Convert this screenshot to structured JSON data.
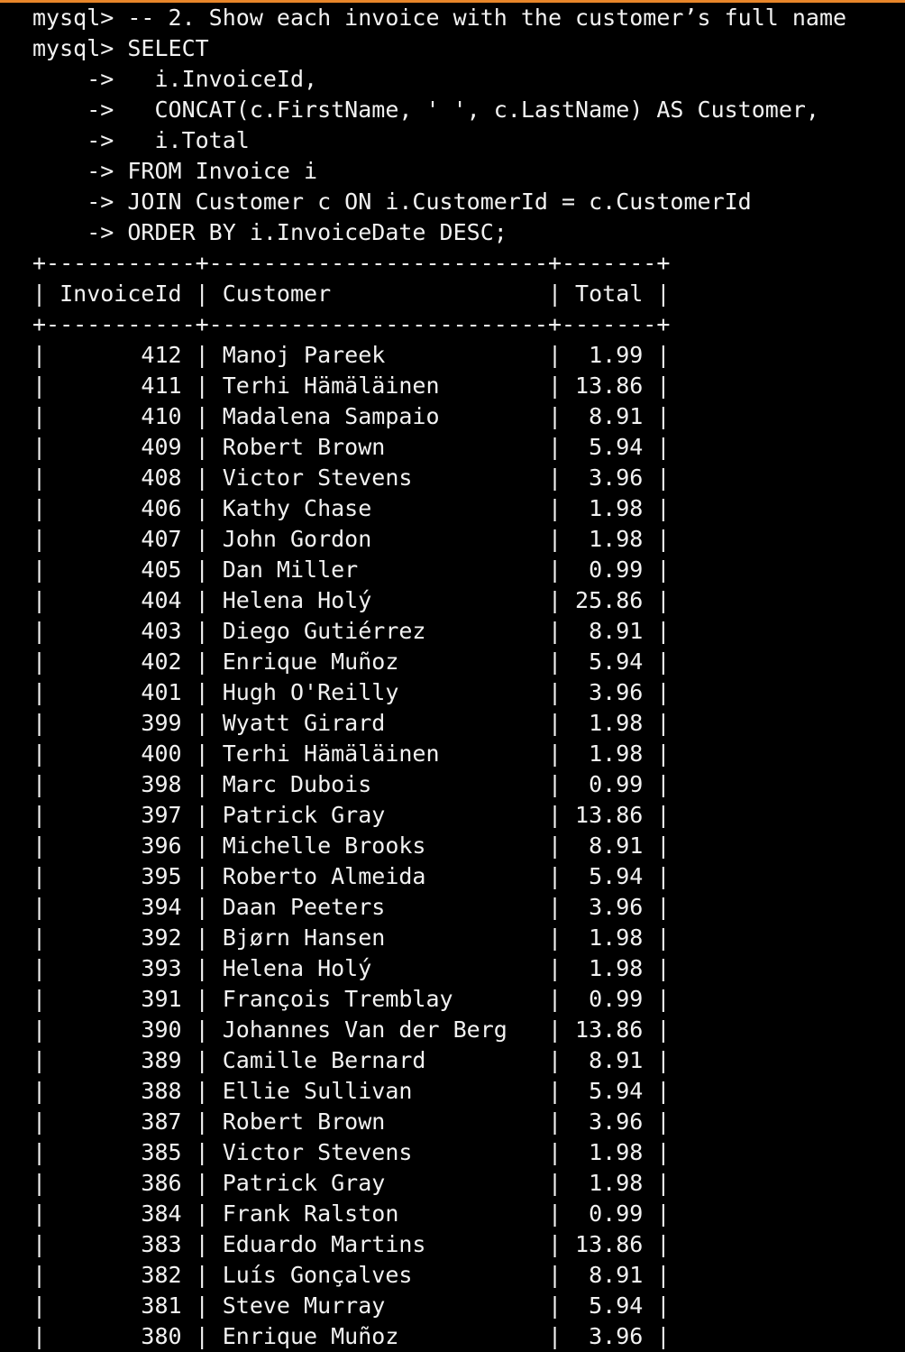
{
  "theme": {
    "background": "#000000",
    "foreground": "#f2f2f2",
    "accent": "#e8862a"
  },
  "session": {
    "prompt": "mysql>",
    "continuation": "    ->",
    "lines": [
      "mysql> -- 2. Show each invoice with the customer’s full name",
      "mysql> SELECT",
      "    ->   i.InvoiceId,",
      "    ->   CONCAT(c.FirstName, ' ', c.LastName) AS Customer,",
      "    ->   i.Total",
      "    -> FROM Invoice i",
      "    -> JOIN Customer c ON i.CustomerId = c.CustomerId",
      "    -> ORDER BY i.InvoiceDate DESC;"
    ]
  },
  "result_table": {
    "border": "+-----------+-------------------------+-------+",
    "header": "| InvoiceId | Customer                | Total |",
    "columns": [
      "InvoiceId",
      "Customer",
      "Total"
    ],
    "rows": [
      {
        "id": "412",
        "customer": "Manoj Pareek",
        "total": "1.99",
        "line": "|       412 | Manoj Pareek            |  1.99 |"
      },
      {
        "id": "411",
        "customer": "Terhi Hämäläinen",
        "total": "13.86",
        "line": "|       411 | Terhi Hämäläinen        | 13.86 |"
      },
      {
        "id": "410",
        "customer": "Madalena Sampaio",
        "total": "8.91",
        "line": "|       410 | Madalena Sampaio        |  8.91 |"
      },
      {
        "id": "409",
        "customer": "Robert Brown",
        "total": "5.94",
        "line": "|       409 | Robert Brown            |  5.94 |"
      },
      {
        "id": "408",
        "customer": "Victor Stevens",
        "total": "3.96",
        "line": "|       408 | Victor Stevens          |  3.96 |"
      },
      {
        "id": "406",
        "customer": "Kathy Chase",
        "total": "1.98",
        "line": "|       406 | Kathy Chase             |  1.98 |"
      },
      {
        "id": "407",
        "customer": "John Gordon",
        "total": "1.98",
        "line": "|       407 | John Gordon             |  1.98 |"
      },
      {
        "id": "405",
        "customer": "Dan Miller",
        "total": "0.99",
        "line": "|       405 | Dan Miller              |  0.99 |"
      },
      {
        "id": "404",
        "customer": "Helena Holý",
        "total": "25.86",
        "line": "|       404 | Helena Holý             | 25.86 |"
      },
      {
        "id": "403",
        "customer": "Diego Gutiérrez",
        "total": "8.91",
        "line": "|       403 | Diego Gutiérrez         |  8.91 |"
      },
      {
        "id": "402",
        "customer": "Enrique Muñoz",
        "total": "5.94",
        "line": "|       402 | Enrique Muñoz           |  5.94 |"
      },
      {
        "id": "401",
        "customer": "Hugh O'Reilly",
        "total": "3.96",
        "line": "|       401 | Hugh O'Reilly           |  3.96 |"
      },
      {
        "id": "399",
        "customer": "Wyatt Girard",
        "total": "1.98",
        "line": "|       399 | Wyatt Girard            |  1.98 |"
      },
      {
        "id": "400",
        "customer": "Terhi Hämäläinen",
        "total": "1.98",
        "line": "|       400 | Terhi Hämäläinen        |  1.98 |"
      },
      {
        "id": "398",
        "customer": "Marc Dubois",
        "total": "0.99",
        "line": "|       398 | Marc Dubois             |  0.99 |"
      },
      {
        "id": "397",
        "customer": "Patrick Gray",
        "total": "13.86",
        "line": "|       397 | Patrick Gray            | 13.86 |"
      },
      {
        "id": "396",
        "customer": "Michelle Brooks",
        "total": "8.91",
        "line": "|       396 | Michelle Brooks         |  8.91 |"
      },
      {
        "id": "395",
        "customer": "Roberto Almeida",
        "total": "5.94",
        "line": "|       395 | Roberto Almeida         |  5.94 |"
      },
      {
        "id": "394",
        "customer": "Daan Peeters",
        "total": "3.96",
        "line": "|       394 | Daan Peeters            |  3.96 |"
      },
      {
        "id": "392",
        "customer": "Bjørn Hansen",
        "total": "1.98",
        "line": "|       392 | Bjørn Hansen            |  1.98 |"
      },
      {
        "id": "393",
        "customer": "Helena Holý",
        "total": "1.98",
        "line": "|       393 | Helena Holý             |  1.98 |"
      },
      {
        "id": "391",
        "customer": "François Tremblay",
        "total": "0.99",
        "line": "|       391 | François Tremblay       |  0.99 |"
      },
      {
        "id": "390",
        "customer": "Johannes Van der Berg",
        "total": "13.86",
        "line": "|       390 | Johannes Van der Berg   | 13.86 |"
      },
      {
        "id": "389",
        "customer": "Camille Bernard",
        "total": "8.91",
        "line": "|       389 | Camille Bernard         |  8.91 |"
      },
      {
        "id": "388",
        "customer": "Ellie Sullivan",
        "total": "5.94",
        "line": "|       388 | Ellie Sullivan          |  5.94 |"
      },
      {
        "id": "387",
        "customer": "Robert Brown",
        "total": "3.96",
        "line": "|       387 | Robert Brown            |  3.96 |"
      },
      {
        "id": "385",
        "customer": "Victor Stevens",
        "total": "1.98",
        "line": "|       385 | Victor Stevens          |  1.98 |"
      },
      {
        "id": "386",
        "customer": "Patrick Gray",
        "total": "1.98",
        "line": "|       386 | Patrick Gray            |  1.98 |"
      },
      {
        "id": "384",
        "customer": "Frank Ralston",
        "total": "0.99",
        "line": "|       384 | Frank Ralston           |  0.99 |"
      },
      {
        "id": "383",
        "customer": "Eduardo Martins",
        "total": "13.86",
        "line": "|       383 | Eduardo Martins         | 13.86 |"
      },
      {
        "id": "382",
        "customer": "Luís Gonçalves",
        "total": "8.91",
        "line": "|       382 | Luís Gonçalves          |  8.91 |"
      },
      {
        "id": "381",
        "customer": "Steve Murray",
        "total": "5.94",
        "line": "|       381 | Steve Murray            |  5.94 |"
      },
      {
        "id": "380",
        "customer": "Enrique Muñoz",
        "total": "3.96",
        "line": "|       380 | Enrique Muñoz           |  3.96 |"
      }
    ]
  }
}
